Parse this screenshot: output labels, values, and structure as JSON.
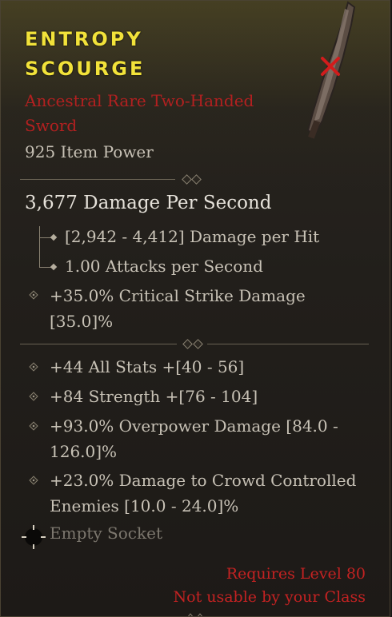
{
  "item": {
    "name_line1": "ENTROPY",
    "name_line2": "SCOURGE",
    "type_line": "Ancestral Rare Two-Handed Sword",
    "item_power": "925 Item Power",
    "weapon_icon": "two-handed-sword-icon",
    "unusable_marker_icon": "red-x-icon"
  },
  "weapon_stats": {
    "dps": "3,677 Damage Per Second",
    "damage_per_hit": "[2,942 - 4,412] Damage per Hit",
    "attacks_per_second": "1.00 Attacks per Second",
    "implicit_line1": "+35.0% Critical Strike Damage",
    "implicit_line2": "[35.0]%"
  },
  "affixes": [
    {
      "line1": "+44 All Stats +[40 - 56]"
    },
    {
      "line1": "+84 Strength +[76 - 104]"
    },
    {
      "line1": "+93.0% Overpower Damage [84.0 -",
      "line2": "126.0]%"
    },
    {
      "line1": "+23.0% Damage to Crowd Controlled",
      "line2": "Enemies [10.0 - 24.0]%"
    }
  ],
  "socket": {
    "label": "Empty Socket",
    "icon": "empty-socket-icon"
  },
  "requirements": {
    "level": "Requires Level 80",
    "class": "Not usable by your Class"
  },
  "colors": {
    "rare_name": "#f2e23a",
    "rare_type": "#b32020",
    "requirement_red": "#c42222",
    "stat_text": "#c8c2b6"
  }
}
